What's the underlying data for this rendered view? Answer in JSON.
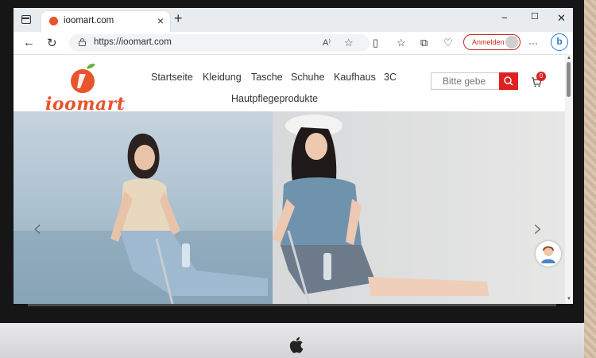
{
  "browser": {
    "tab_title": "ioomart.com",
    "tab_close_icon": "close-icon",
    "new_tab_symbol": "+",
    "window_controls": [
      "−",
      "☐",
      "✕"
    ],
    "url": "https://ioomart.com",
    "signin_label": "Anmelden",
    "more_symbol": "···",
    "bing_label": "b"
  },
  "site": {
    "logo_text": "ioomart",
    "nav": [
      "Startseite",
      "Kleidung",
      "Tasche",
      "Schuhe",
      "Kaufhaus",
      "3C",
      "Hautpflegeprodukte"
    ],
    "search_placeholder": "Bitte gebe",
    "cart_count": "0"
  },
  "hero": {
    "prev_symbol": "‹",
    "next_symbol": "›"
  },
  "colors": {
    "brand": "#e8542c",
    "search_button": "#e02020",
    "signin_border": "#c42b1c",
    "bing": "#2b78d4"
  }
}
